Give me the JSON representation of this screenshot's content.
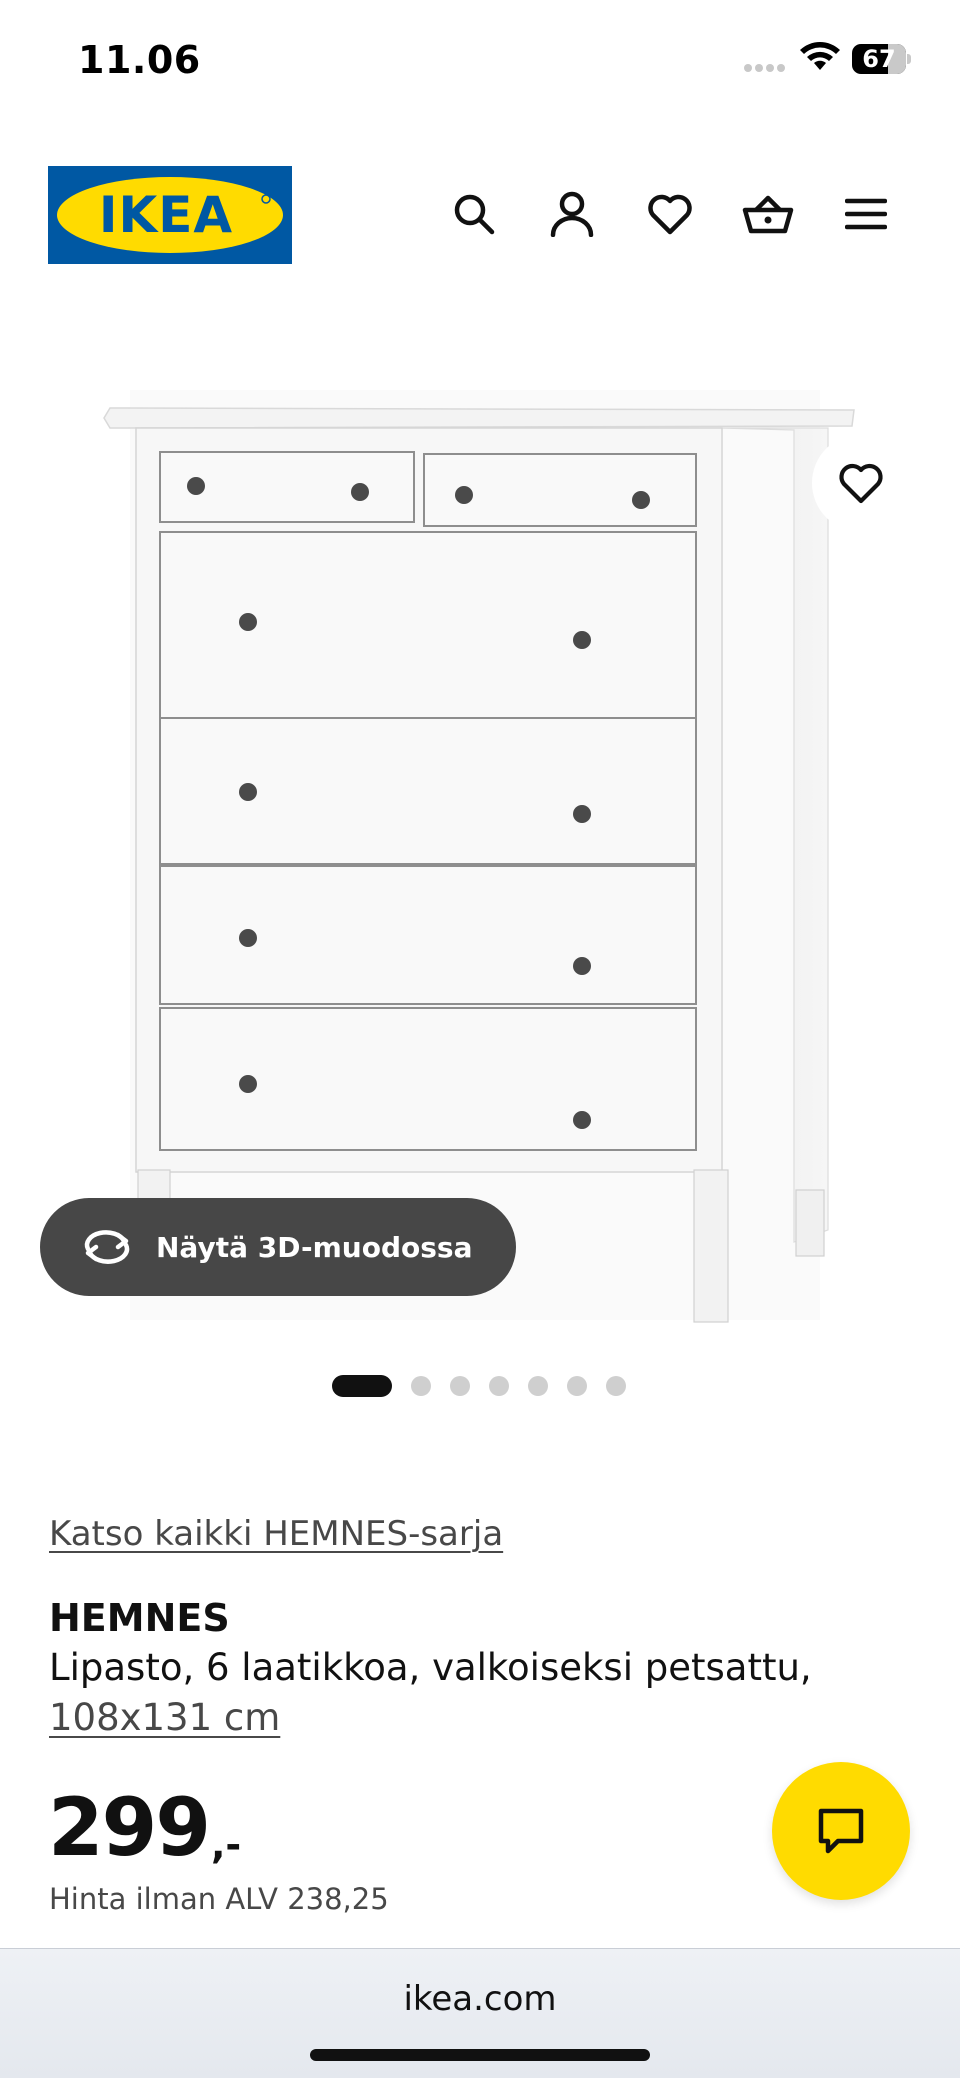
{
  "status_bar": {
    "time": "11.06",
    "battery": "67",
    "battery_level_percent": 67
  },
  "header": {
    "logo_text": "IKEA",
    "icons": [
      "search-icon",
      "user-icon",
      "heart-icon",
      "basket-icon",
      "menu-icon"
    ]
  },
  "gallery": {
    "btn_3d_label": "Näytä 3D-muodossa",
    "image_count": 7,
    "active_index": 0
  },
  "product": {
    "series_link": "Katso kaikki HEMNES-sarja",
    "name": "HEMNES",
    "description": "Lipasto, 6 laatikkoa, valkoiseksi petsattu,",
    "size": "108x131 cm",
    "price": "299",
    "price_suffix": ",-",
    "price_ex_vat": "Hinta ilman ALV 238,25"
  },
  "browser": {
    "url": "ikea.com"
  },
  "colors": {
    "ikea_blue": "#0058a3",
    "ikea_yellow": "#ffdb00",
    "button_dark": "#474747"
  }
}
